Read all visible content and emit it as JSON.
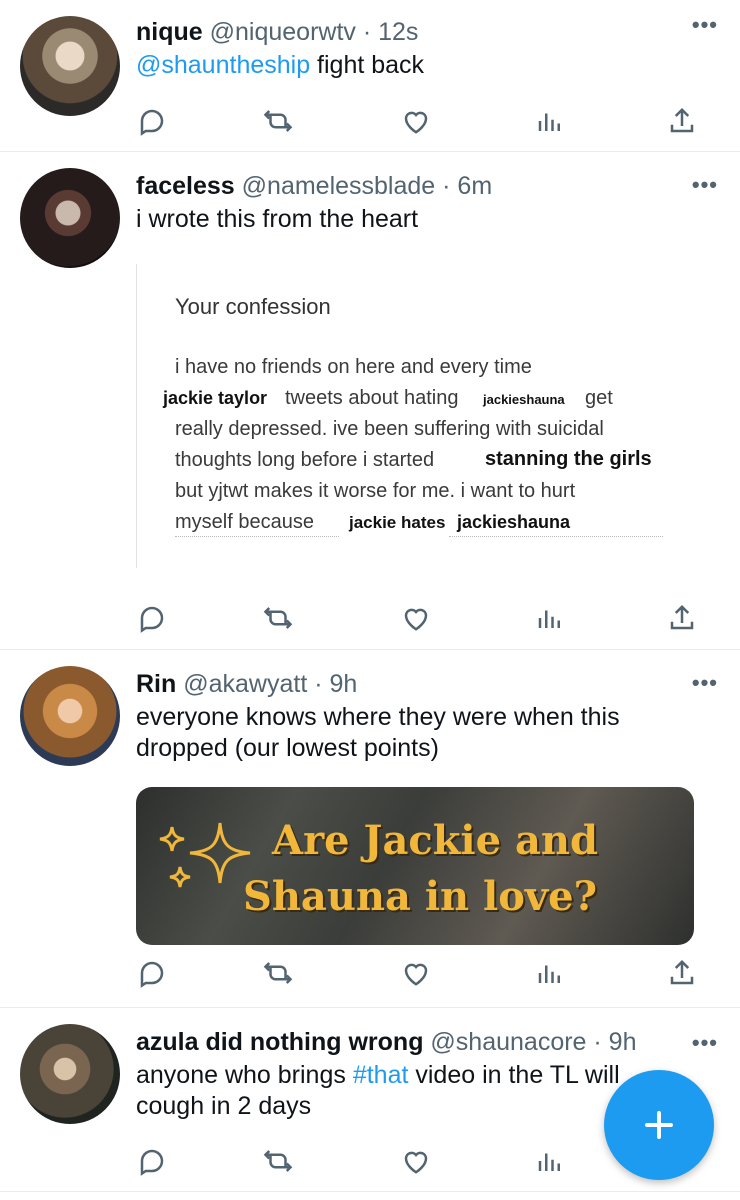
{
  "tweets": [
    {
      "name": "nique",
      "meta": "@niqueorwtv · 12s",
      "mention": "@shauntheship",
      "text_after": " fight back",
      "avatar_icon": "avatar-photo"
    },
    {
      "name": "faceless",
      "meta": "@namelessblade · 6m",
      "text": "i wrote this from the heart",
      "avatar_icon": "avatar-photo"
    },
    {
      "name": "Rin",
      "meta": "@akawyatt · 9h",
      "text_line1": "everyone knows where they were when this",
      "text_line2": "dropped (our lowest points)",
      "avatar_icon": "avatar-photo"
    },
    {
      "name": "azula did nothing wrong",
      "meta": "@shaunacore · 9h",
      "text_before": "anyone who brings ",
      "hashtag": "#that",
      "text_after": " video in the TL will",
      "text_line2": "cough in 2 days",
      "avatar_icon": "avatar-photo"
    }
  ],
  "confession": {
    "title": "Your confession",
    "line1": "i have no friends on here and every time",
    "line2_mid": "tweets about hating",
    "line2_end": "get",
    "line3": "really depressed. ive been suffering with suicidal",
    "line4": "thoughts long before i started",
    "line5": "but yjtwt makes it worse for me. i want to hurt",
    "line6": "myself because",
    "redact_jackie_taylor": "jackie taylor",
    "redact_jackieshauna_small": "jackieshauna",
    "redact_stanning": "stanning the girls",
    "redact_jackie_hates": "jackie hates",
    "redact_jackieshauna": "jackieshauna"
  },
  "media": {
    "line1": "Are Jackie and",
    "line2": "Shauna in love?"
  },
  "more_label": "•••",
  "fab_icon": "plus-icon",
  "colors": {
    "accent": "#1d9bf0",
    "muted": "#536471",
    "text": "#0f1419"
  }
}
